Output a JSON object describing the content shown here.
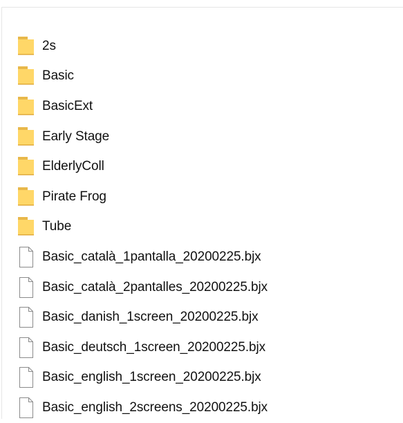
{
  "explorer": {
    "items": [
      {
        "name": "2s",
        "type": "folder"
      },
      {
        "name": "Basic",
        "type": "folder"
      },
      {
        "name": "BasicExt",
        "type": "folder"
      },
      {
        "name": "Early Stage",
        "type": "folder"
      },
      {
        "name": "ElderlyColl",
        "type": "folder"
      },
      {
        "name": "Pirate Frog",
        "type": "folder"
      },
      {
        "name": "Tube",
        "type": "folder"
      },
      {
        "name": "Basic_català_1pantalla_20200225.bjx",
        "type": "file"
      },
      {
        "name": "Basic_català_2pantalles_20200225.bjx",
        "type": "file"
      },
      {
        "name": "Basic_danish_1screen_20200225.bjx",
        "type": "file"
      },
      {
        "name": "Basic_deutsch_1screen_20200225.bjx",
        "type": "file"
      },
      {
        "name": "Basic_english_1screen_20200225.bjx",
        "type": "file"
      },
      {
        "name": "Basic_english_2screens_20200225.bjx",
        "type": "file"
      }
    ]
  },
  "colors": {
    "folder_fill": "#ffd768",
    "folder_tab": "#e8b84a",
    "file_outline": "#8a8a8a",
    "file_fill": "#ffffff",
    "text": "#111111"
  },
  "icons": {
    "folder": "folder-icon",
    "file": "file-icon"
  }
}
